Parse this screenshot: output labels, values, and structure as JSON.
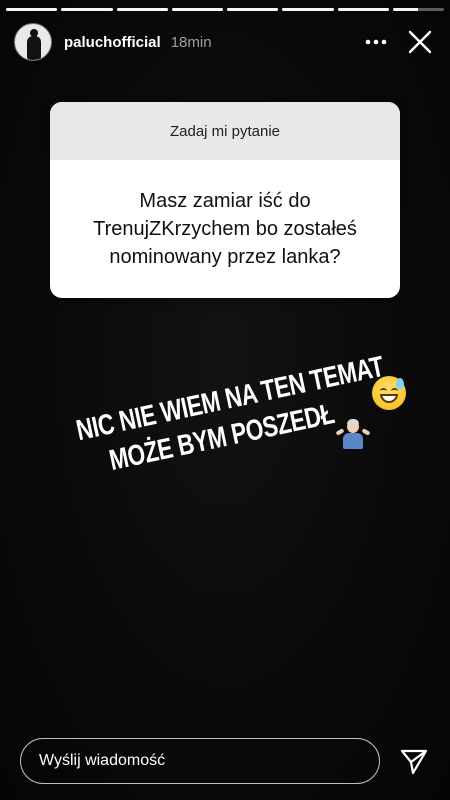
{
  "progress": {
    "segments": [
      1,
      1,
      1,
      1,
      1,
      1,
      1,
      0.5
    ]
  },
  "header": {
    "username": "paluchofficial",
    "time": "18min"
  },
  "question": {
    "prompt": "Zadaj mi pytanie",
    "text": "Masz zamiar iść do TrenujZKrzychem bo zostałeś nominowany przez lanka?"
  },
  "answer": {
    "line1": "NIC NIE WIEM NA TEN TEMAT",
    "line2": "MOŻE BYM POSZEDŁ",
    "emoji1": "grinning-face-with-sweat-icon",
    "emoji2": "person-shrugging-icon"
  },
  "reply": {
    "placeholder": "Wyślij wiadomość"
  },
  "colors": {
    "background": "#0b0b0b",
    "card": "#ffffff",
    "card_header": "#e8e8e8"
  }
}
